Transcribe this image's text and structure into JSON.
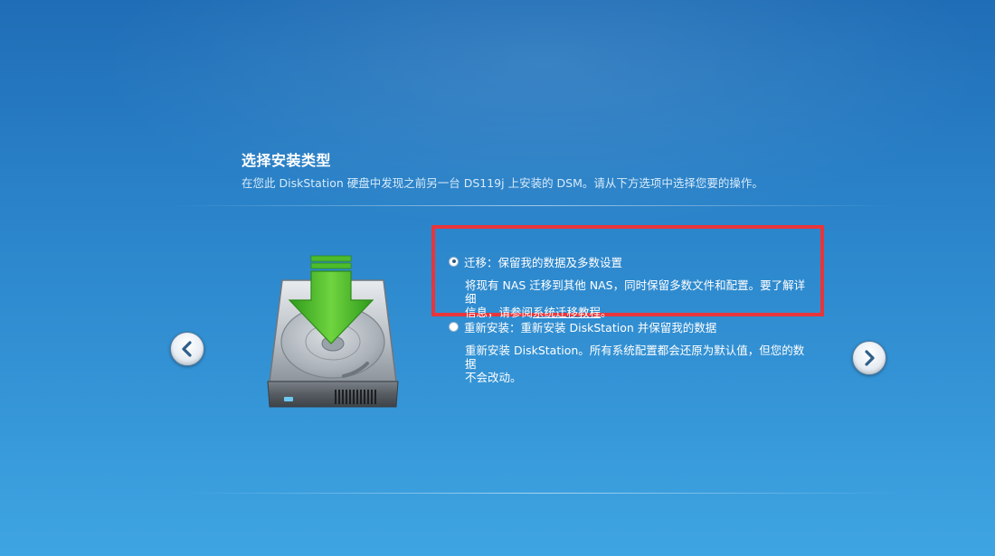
{
  "header": {
    "title": "选择安装类型",
    "subtitle": "在您此 DiskStation 硬盘中发现之前另一台 DS119j 上安装的 DSM。请从下方选项中选择您要的操作。"
  },
  "options": {
    "migrate": {
      "label": "迁移：保留我的数据及多数设置",
      "selected": true,
      "desc_line1": "将现有 NAS 迁移到其他 NAS，同时保留多数文件和配置。要了解详细",
      "desc_line2_prefix": "信息，请参阅",
      "desc_link": "系统迁移教程",
      "desc_line2_suffix": "。"
    },
    "reinstall": {
      "label": "重新安装：重新安装 DiskStation 并保留我的数据",
      "selected": false,
      "desc_line1": "重新安装 DiskStation。所有系统配置都会还原为默认值，但您的数据",
      "desc_line2": "不会改动。"
    }
  },
  "icons": {
    "prev": "chevron-left-icon",
    "next": "chevron-right-icon",
    "illustration": "hard-drive-download-icon"
  },
  "colors": {
    "highlight": "#e8353a",
    "arrow_green": "#4cbc2c"
  }
}
